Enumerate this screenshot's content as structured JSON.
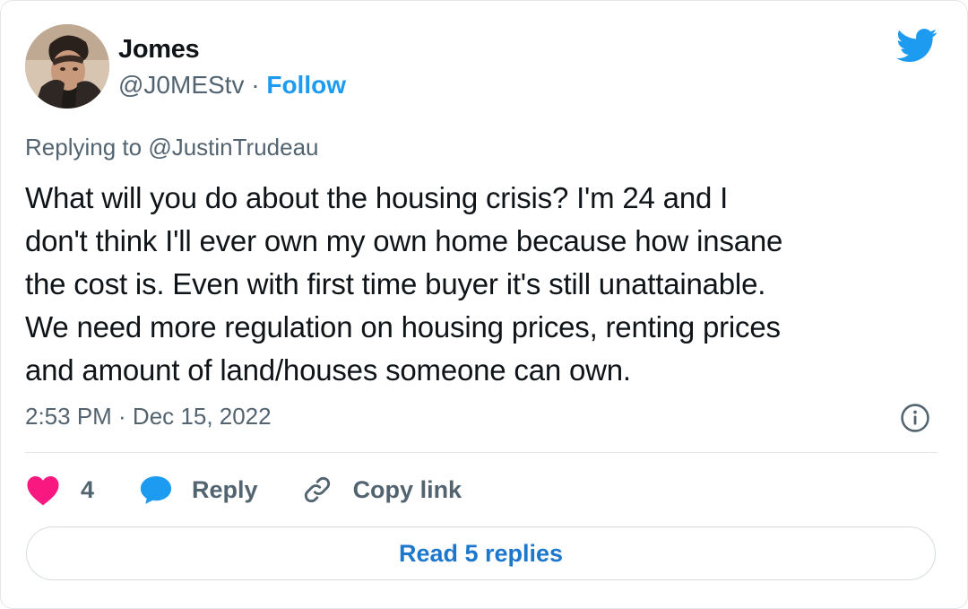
{
  "tweet": {
    "author": {
      "name": "Jomes",
      "handle": "@J0MEStv",
      "separator": "·",
      "follow_label": "Follow"
    },
    "replying_prefix": "Replying to",
    "replying_to": "@JustinTrudeau",
    "text_lines": [
      "What will you do about the housing crisis? I'm 24 and I",
      "don't think I'll ever own my own home because how insane",
      "the cost is. Even with first time buyer it's still unattainable.",
      "We need more regulation on housing prices, renting prices",
      "and amount of land/houses someone can own."
    ],
    "timestamp": "2:53 PM · Dec 15, 2022"
  },
  "actions": {
    "like_count": "4",
    "reply_label": "Reply",
    "copy_link_label": "Copy link"
  },
  "read_replies_label": "Read 5 replies",
  "colors": {
    "brand_blue": "#1d9bf0",
    "like_pink": "#f91880",
    "reply_blue": "#1d9bf0",
    "secondary_text": "#536471"
  },
  "icons": {
    "brand": "twitter-bird-icon",
    "info": "info-icon",
    "like": "heart-icon",
    "reply": "speech-bubble-icon",
    "copy": "link-icon"
  }
}
